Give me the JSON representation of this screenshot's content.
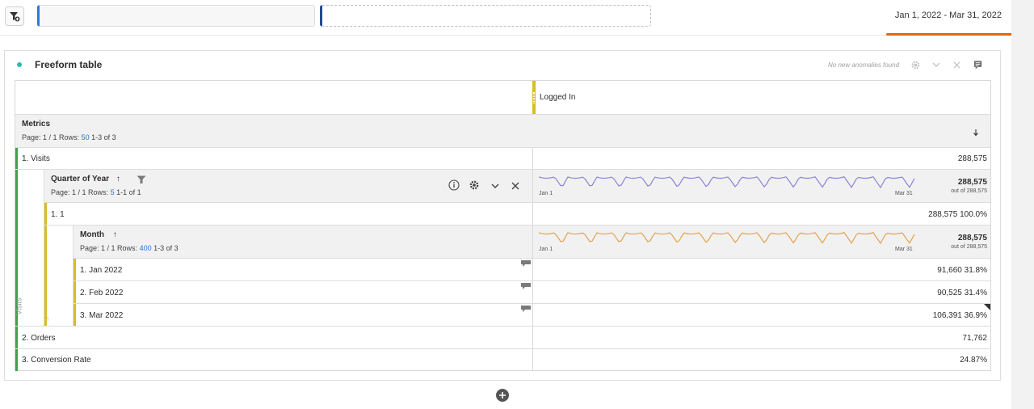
{
  "header": {
    "date_range": "Jan 1, 2022 - Mar 31, 2022",
    "accent_color": "#e0660f"
  },
  "panel": {
    "title": "Freeform table",
    "anomaly_text": "No new anomalies found"
  },
  "table": {
    "column_header": "Logged In",
    "metrics": {
      "title": "Metrics",
      "page_info": "Page: 1 / 1 Rows:",
      "rows_count": "50",
      "range": "1-3 of 3",
      "sort_icon": "arrow-down"
    },
    "rows": [
      {
        "label": "1.  Visits",
        "value": "288,575"
      },
      {
        "label": "2.  Orders",
        "value": "71,762"
      },
      {
        "label": "3.  Conversion Rate",
        "value": "24.87%"
      }
    ],
    "quarter": {
      "title": "Quarter of Year",
      "page_info": "Page: 1 / 1 Rows:",
      "rows_count": "5",
      "range": "1-1 of 1",
      "spark_start": "Jan 1",
      "spark_end": "Mar 31",
      "total": "288,575",
      "total_sub": "out of 288,575",
      "spark_color": "#8a84d6",
      "row": {
        "label": "1.  1",
        "value": "288,575",
        "pct": "100.0%"
      }
    },
    "month": {
      "title": "Month",
      "page_info": "Page: 1 / 1 Rows:",
      "rows_count": "400",
      "range": "1-3 of 3",
      "spark_start": "Jan 1",
      "spark_end": "Mar 31",
      "total": "288,575",
      "total_sub": "out of 288,575",
      "spark_color": "#e3a24f",
      "rows": [
        {
          "label": "1.  Jan 2022",
          "value": "91,660",
          "pct": "31.8%"
        },
        {
          "label": "2.  Feb 2022",
          "value": "90,525",
          "pct": "31.4%"
        },
        {
          "label": "3.  Mar 2022",
          "value": "106,391",
          "pct": "36.9%"
        }
      ]
    },
    "side_label": "Visits"
  }
}
